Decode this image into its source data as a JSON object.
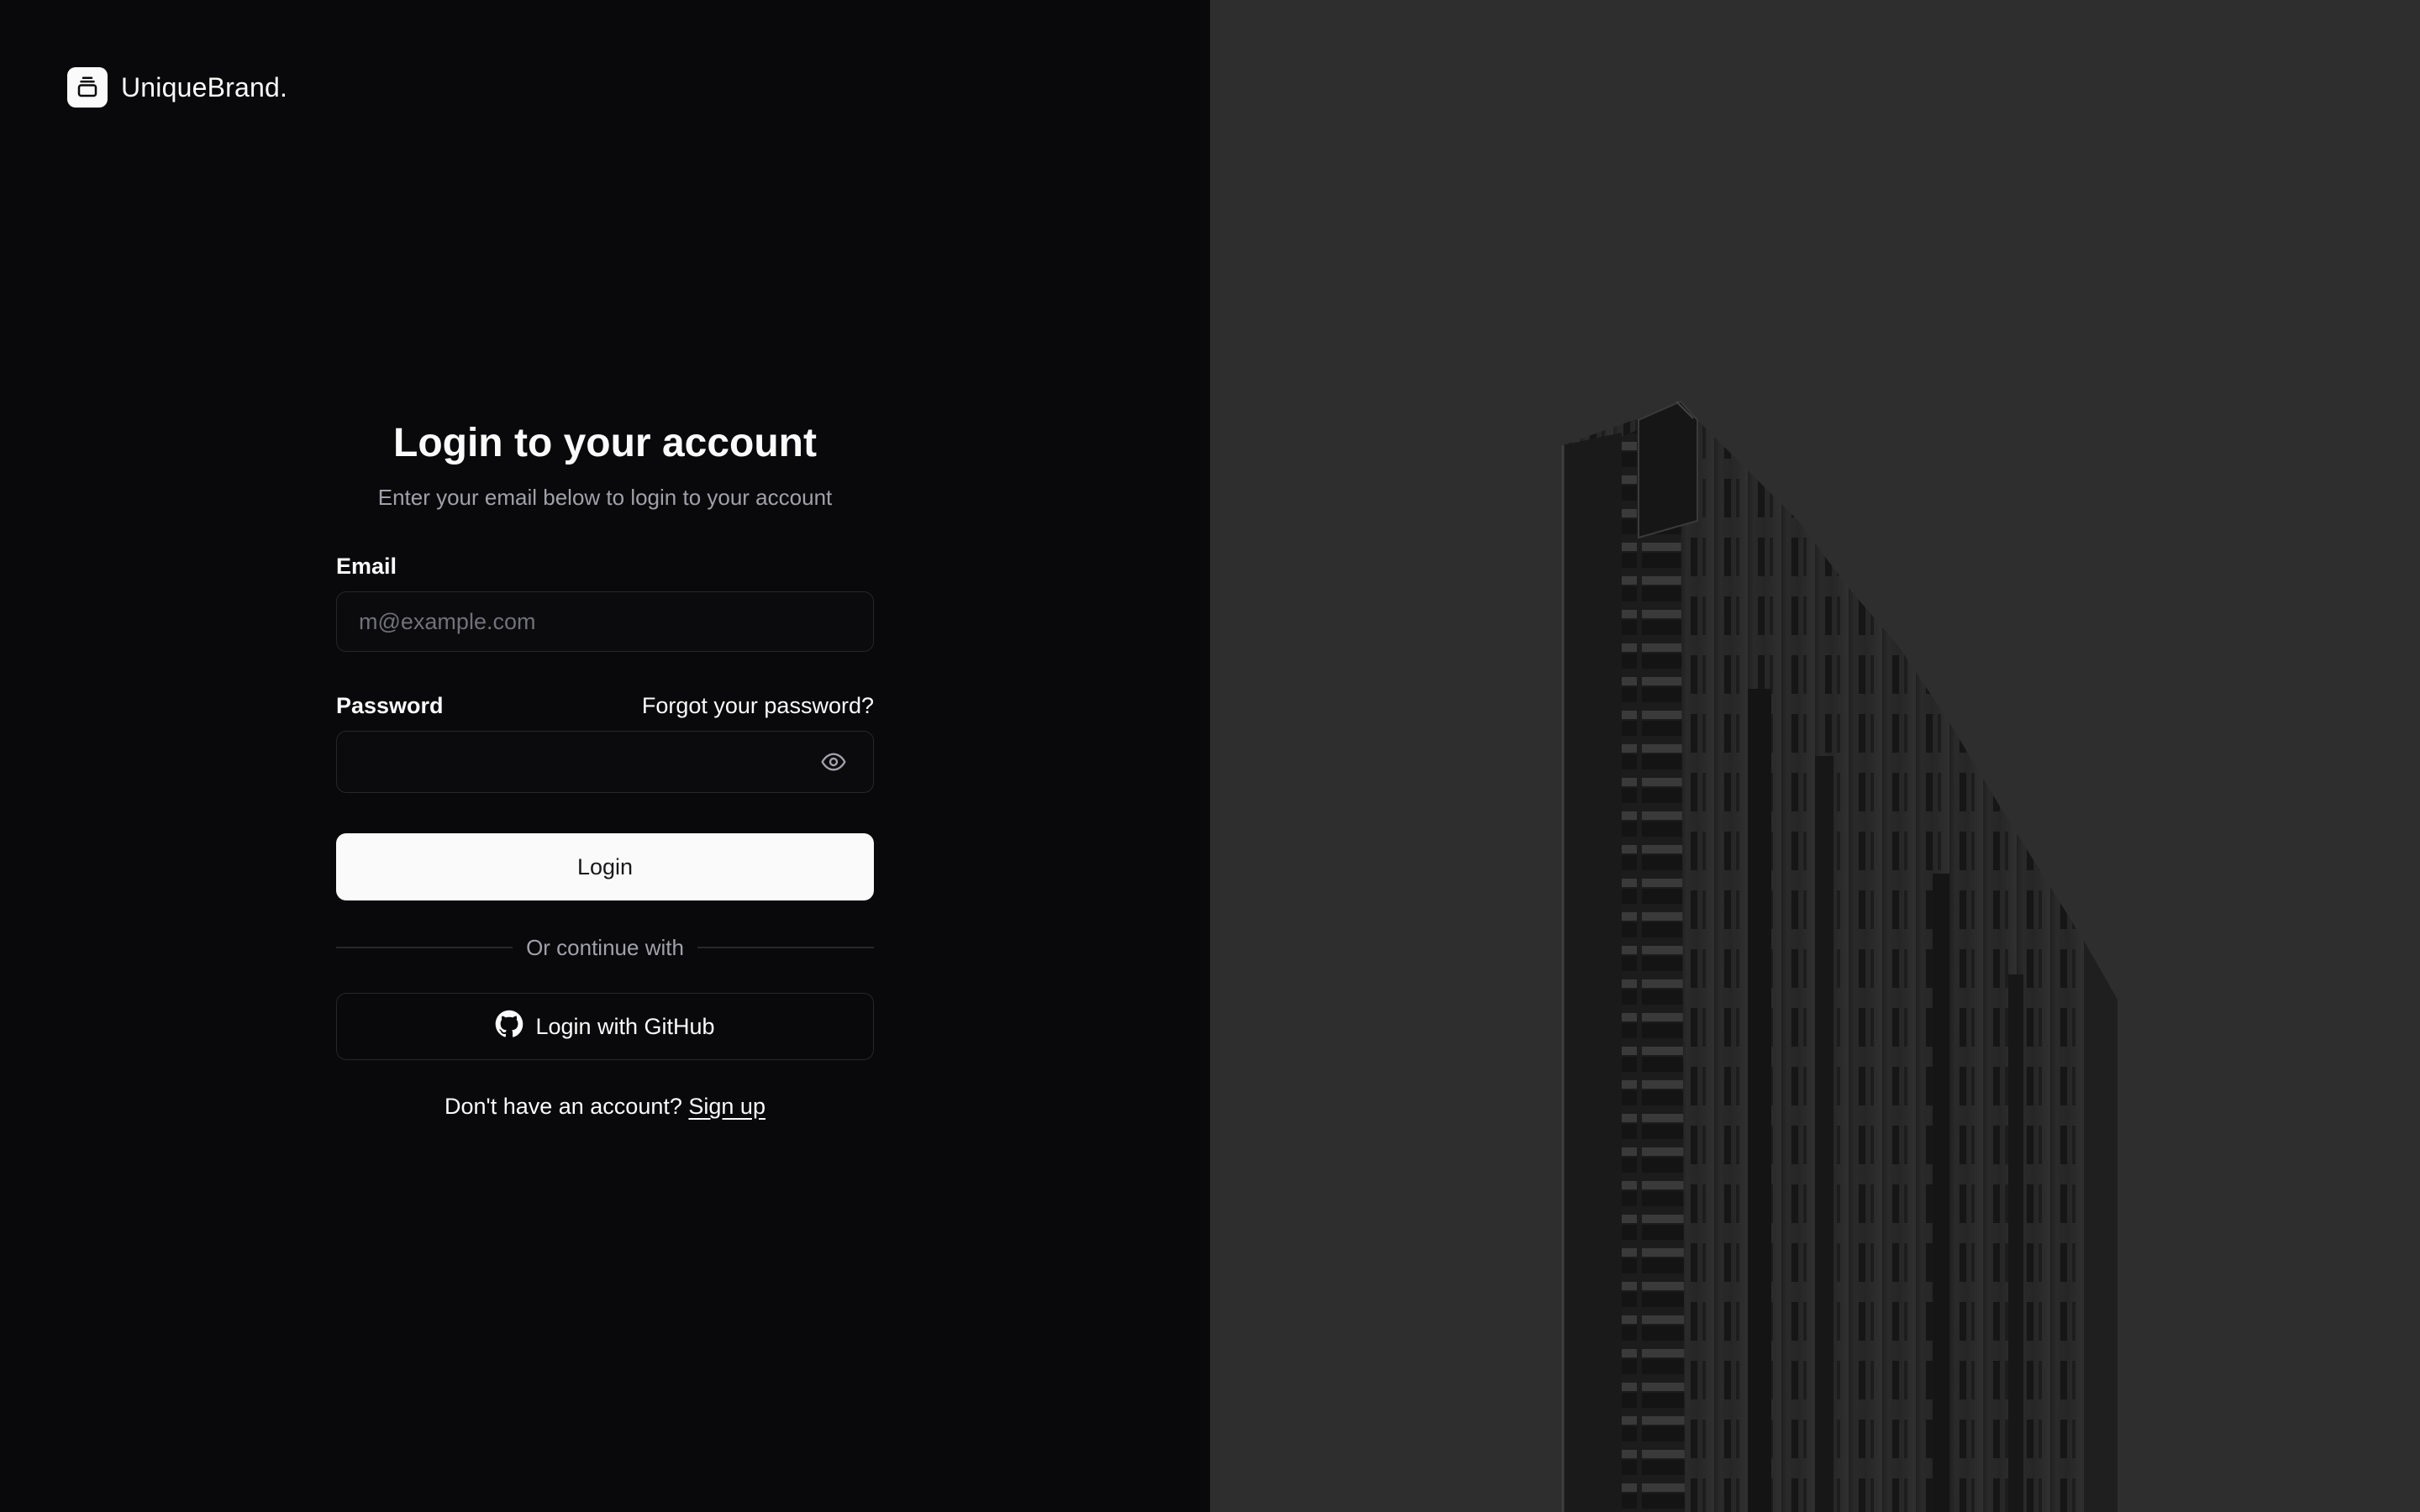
{
  "brand": {
    "name": "UniqueBrand."
  },
  "login": {
    "title": "Login to your account",
    "subtitle": "Enter your email below to login to your account",
    "email_label": "Email",
    "email_placeholder": "m@example.com",
    "password_label": "Password",
    "forgot_link": "Forgot your password?",
    "login_button": "Login",
    "divider_text": "Or continue with",
    "github_button": "Login with GitHub",
    "signup_prompt": "Don't have an account?",
    "signup_link": "Sign up"
  },
  "icons": {
    "brand": "stacked-box-icon",
    "password_toggle": "eye-icon",
    "github": "github-icon"
  },
  "colors": {
    "left_background": "#09090b",
    "right_background": "#2e2e2e",
    "primary_button": "#fafafa",
    "border": "#27272a",
    "muted_text": "#a1a1aa"
  }
}
